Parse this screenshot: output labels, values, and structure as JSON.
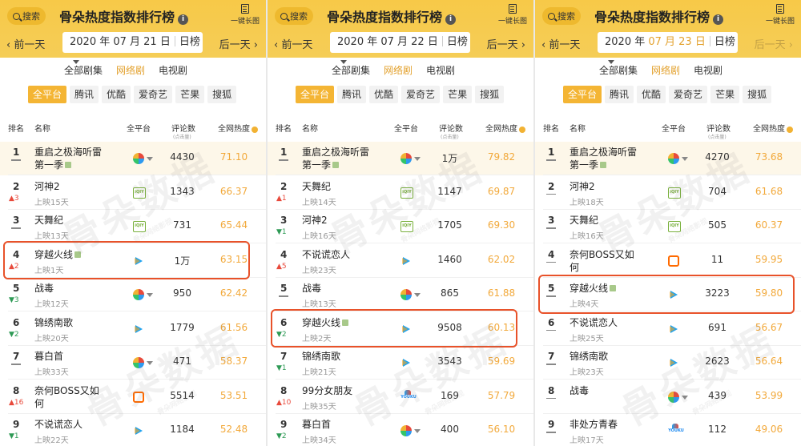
{
  "app": {
    "title": "骨朵热度指数排行榜",
    "search_label": "搜索",
    "longshot_label": "一键长图",
    "prev_label": "前一天",
    "next_label": "后一天",
    "period_label": "日榜",
    "watermark": "骨朵数据",
    "watermark_sub": "骨朵网络影视"
  },
  "tabs": [
    "全部剧集",
    "网络剧",
    "电视剧"
  ],
  "platform_filters": [
    "全平台",
    "腾讯",
    "优酷",
    "爱奇艺",
    "芒果",
    "搜狐"
  ],
  "columns": {
    "rank": "排名",
    "name": "名称",
    "platform": "全平台",
    "comments": "评论数",
    "comments_sub": "(点击量)",
    "heat": "全网热度"
  },
  "colors": {
    "brand_yellow": "#f7c948",
    "heat_orange": "#f2a93b",
    "rank_up": "#e84a3c",
    "rank_down": "#2e9a55",
    "highlight": "#e8522a"
  },
  "panels": [
    {
      "date_prefix": "2020 年 07 月 21 日",
      "date_highlight": "",
      "date_suffix": "",
      "next_disabled": false,
      "highlight_rank": 4,
      "rows": [
        {
          "rank": "1",
          "name": "重启之极海听雷第一季",
          "sub": "",
          "tag": true,
          "change": "",
          "dir": "",
          "icon": "multi",
          "comments": "4430",
          "heat": "71.10"
        },
        {
          "rank": "2",
          "name": "河神2",
          "sub": "上映15天",
          "tag": false,
          "change": "3",
          "dir": "up",
          "icon": "iqiyi",
          "comments": "1343",
          "heat": "66.37"
        },
        {
          "rank": "3",
          "name": "天舞纪",
          "sub": "上映13天",
          "tag": false,
          "change": "",
          "dir": "",
          "icon": "iqiyi",
          "comments": "731",
          "heat": "65.44"
        },
        {
          "rank": "4",
          "name": "穿越火线",
          "sub": "上映1天",
          "tag": true,
          "change": "2",
          "dir": "up",
          "icon": "tencent",
          "comments": "1万",
          "heat": "63.15"
        },
        {
          "rank": "5",
          "name": "战毒",
          "sub": "上映12天",
          "tag": false,
          "change": "3",
          "dir": "down",
          "icon": "multi",
          "comments": "950",
          "heat": "62.42"
        },
        {
          "rank": "6",
          "name": "锦绣南歌",
          "sub": "上映20天",
          "tag": false,
          "change": "2",
          "dir": "down",
          "icon": "tencent",
          "comments": "1779",
          "heat": "61.56"
        },
        {
          "rank": "7",
          "name": "暮白首",
          "sub": "上映33天",
          "tag": false,
          "change": "",
          "dir": "",
          "icon": "multi",
          "comments": "471",
          "heat": "58.37"
        },
        {
          "rank": "8",
          "name": "奈何BOSS又如何",
          "sub": "",
          "tag": false,
          "change": "16",
          "dir": "up",
          "icon": "mgtv",
          "comments": "5514",
          "heat": "53.51"
        },
        {
          "rank": "9",
          "name": "不说谎恋人",
          "sub": "上映22天",
          "tag": false,
          "change": "1",
          "dir": "down",
          "icon": "tencent",
          "comments": "1184",
          "heat": "52.48"
        }
      ]
    },
    {
      "date_prefix": "2020 年 07 月 22 日",
      "date_highlight": "",
      "date_suffix": "",
      "next_disabled": false,
      "highlight_rank": 6,
      "rows": [
        {
          "rank": "1",
          "name": "重启之极海听雷第一季",
          "sub": "",
          "tag": true,
          "change": "",
          "dir": "",
          "icon": "multi",
          "comments": "1万",
          "heat": "79.82"
        },
        {
          "rank": "2",
          "name": "天舞纪",
          "sub": "上映14天",
          "tag": false,
          "change": "1",
          "dir": "up",
          "icon": "iqiyi",
          "comments": "1147",
          "heat": "69.87"
        },
        {
          "rank": "3",
          "name": "河神2",
          "sub": "上映16天",
          "tag": false,
          "change": "1",
          "dir": "down",
          "icon": "iqiyi",
          "comments": "1705",
          "heat": "69.30"
        },
        {
          "rank": "4",
          "name": "不说谎恋人",
          "sub": "上映23天",
          "tag": false,
          "change": "5",
          "dir": "up",
          "icon": "tencent",
          "comments": "1460",
          "heat": "62.02"
        },
        {
          "rank": "5",
          "name": "战毒",
          "sub": "上映13天",
          "tag": false,
          "change": "",
          "dir": "",
          "icon": "multi",
          "comments": "865",
          "heat": "61.88"
        },
        {
          "rank": "6",
          "name": "穿越火线",
          "sub": "上映2天",
          "tag": true,
          "change": "2",
          "dir": "down",
          "icon": "tencent",
          "comments": "9508",
          "heat": "60.13"
        },
        {
          "rank": "7",
          "name": "锦绣南歌",
          "sub": "上映21天",
          "tag": false,
          "change": "1",
          "dir": "down",
          "icon": "tencent",
          "comments": "3543",
          "heat": "59.69"
        },
        {
          "rank": "8",
          "name": "99分女朋友",
          "sub": "上映35天",
          "tag": false,
          "change": "10",
          "dir": "up",
          "icon": "youku",
          "comments": "169",
          "heat": "57.79"
        },
        {
          "rank": "9",
          "name": "暮白首",
          "sub": "上映34天",
          "tag": false,
          "change": "2",
          "dir": "down",
          "icon": "multi",
          "comments": "400",
          "heat": "56.10"
        }
      ]
    },
    {
      "date_prefix": "2020 年 ",
      "date_highlight": "07 月 23 日",
      "date_suffix": "",
      "next_disabled": true,
      "highlight_rank": 5,
      "rows": [
        {
          "rank": "1",
          "name": "重启之极海听雷第一季",
          "sub": "",
          "tag": true,
          "change": "",
          "dir": "",
          "icon": "multi",
          "comments": "4270",
          "heat": "73.68"
        },
        {
          "rank": "2",
          "name": "河神2",
          "sub": "上映18天",
          "tag": false,
          "change": "",
          "dir": "",
          "icon": "iqiyi",
          "comments": "704",
          "heat": "61.68"
        },
        {
          "rank": "3",
          "name": "天舞纪",
          "sub": "上映16天",
          "tag": false,
          "change": "",
          "dir": "",
          "icon": "iqiyi",
          "comments": "505",
          "heat": "60.37"
        },
        {
          "rank": "4",
          "name": "奈何BOSS又如何",
          "sub": "",
          "tag": false,
          "change": "",
          "dir": "",
          "icon": "mgtv",
          "comments": "11",
          "heat": "59.95"
        },
        {
          "rank": "5",
          "name": "穿越火线",
          "sub": "上映4天",
          "tag": true,
          "change": "",
          "dir": "",
          "icon": "tencent",
          "comments": "3223",
          "heat": "59.80"
        },
        {
          "rank": "6",
          "name": "不说谎恋人",
          "sub": "上映25天",
          "tag": false,
          "change": "",
          "dir": "",
          "icon": "tencent",
          "comments": "691",
          "heat": "56.67"
        },
        {
          "rank": "7",
          "name": "锦绣南歌",
          "sub": "上映23天",
          "tag": false,
          "change": "",
          "dir": "",
          "icon": "tencent",
          "comments": "2623",
          "heat": "56.64"
        },
        {
          "rank": "8",
          "name": "战毒",
          "sub": "",
          "tag": false,
          "change": "",
          "dir": "",
          "icon": "multi",
          "comments": "439",
          "heat": "53.99"
        },
        {
          "rank": "9",
          "name": "非处方青春",
          "sub": "上映17天",
          "tag": false,
          "change": "",
          "dir": "",
          "icon": "youku",
          "comments": "112",
          "heat": "49.06"
        }
      ]
    }
  ]
}
